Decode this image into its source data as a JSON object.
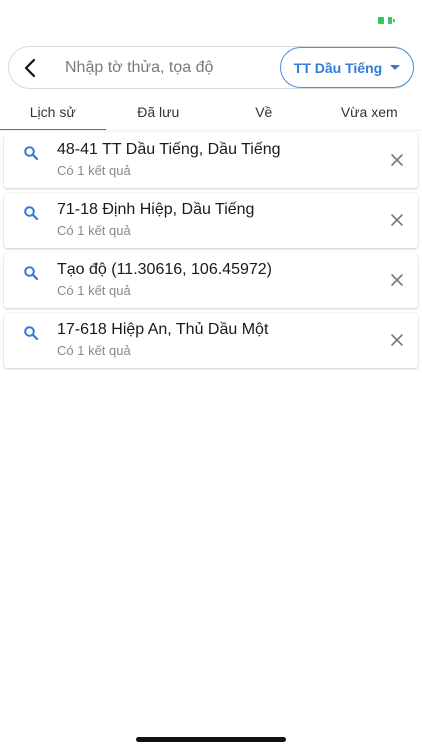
{
  "status_bar": {
    "battery_icon": "battery-charging-icon",
    "battery_color": "#34c759"
  },
  "search": {
    "back_icon": "chevron-left-icon",
    "placeholder": "Nhập tờ thửa, tọa độ",
    "value": "",
    "region_selected": "TT Dầu Tiếng",
    "region_icon": "caret-down-icon",
    "accent_color": "#2f7cdc"
  },
  "tabs": [
    {
      "label": "Lịch sử",
      "active": true
    },
    {
      "label": "Đã lưu",
      "active": false
    },
    {
      "label": "Về",
      "active": false
    },
    {
      "label": "Vừa xem",
      "active": false
    }
  ],
  "history": [
    {
      "title": "48-41 TT Dầu Tiếng, Dầu Tiếng",
      "subtitle": "Có 1 kết quả"
    },
    {
      "title": "71-18 Định Hiệp, Dầu Tiếng",
      "subtitle": "Có 1 kết quả"
    },
    {
      "title": "Tạo độ (11.30616, 106.45972)",
      "subtitle": "Có 1 kết quả"
    },
    {
      "title": "17-618 Hiệp An, Thủ Dầu Một",
      "subtitle": "Có 1 kết quả"
    }
  ]
}
